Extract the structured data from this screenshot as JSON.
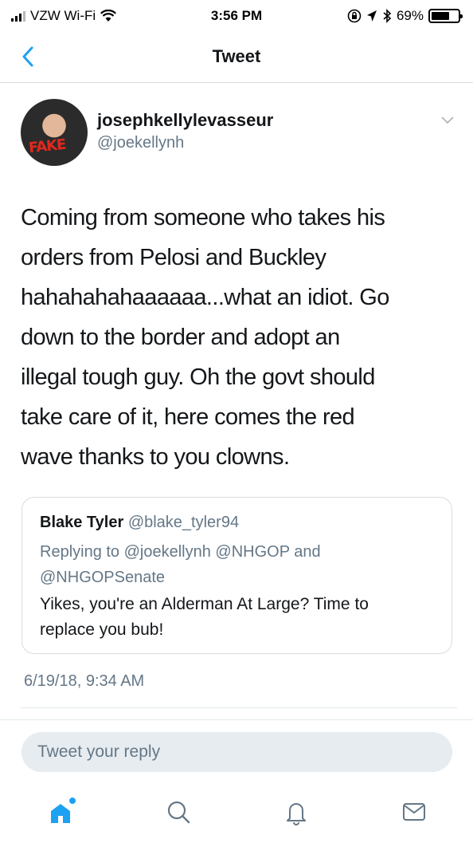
{
  "status_bar": {
    "carrier": "VZW Wi-Fi",
    "time": "3:56 PM",
    "battery": "69%",
    "battery_level": 0.69,
    "icons": [
      "signal-icon",
      "wifi-icon",
      "lock-rotation-icon",
      "location-icon",
      "bluetooth-icon",
      "battery-icon"
    ]
  },
  "nav": {
    "title": "Tweet",
    "back_icon": "chevron-left-icon"
  },
  "tweet": {
    "avatar_label": "FAKE",
    "display_name": "josephkellylevasseur",
    "handle": "@joekellynh",
    "text": "Coming from someone who takes his\norders from Pelosi and Buckley\nhahahahahaaaaaa...what an idiot. Go\ndown to the border and adopt an\nillegal tough guy. Oh the govt should\ntake care of it, here comes the red\nwave thanks to you clowns.",
    "timestamp": "6/19/18, 9:34 AM"
  },
  "quoted_tweet": {
    "name": "Blake Tyler",
    "handle": "@blake_tyler94",
    "replying_to": "Replying to @joekellynh @NHGOP and\n@NHGOPSenate",
    "text": "Yikes, you're an Alderman At Large? Time to\nreplace you bub!"
  },
  "reply": {
    "placeholder": "Tweet your reply"
  },
  "tab_bar": {
    "tabs": [
      "home-icon",
      "search-icon",
      "notifications-icon",
      "messages-icon"
    ]
  },
  "colors": {
    "accent": "#1da1f2",
    "secondary_text": "#657786",
    "text": "#14171a",
    "border": "#dcdcdc",
    "reply_bg": "#e6ecf0"
  }
}
